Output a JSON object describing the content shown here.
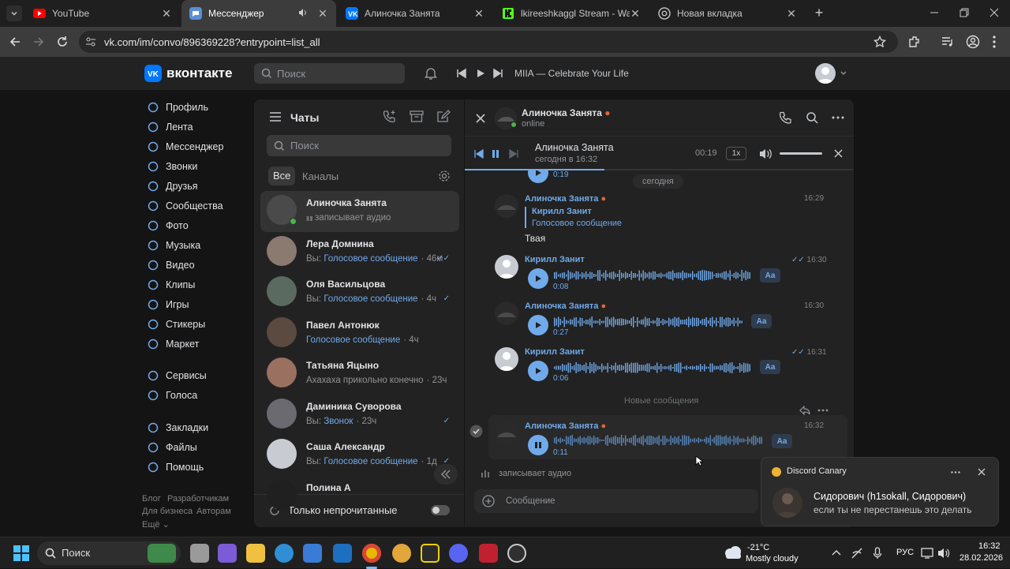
{
  "browser": {
    "tabs": [
      {
        "title": "YouTube",
        "icon": "youtube-icon"
      },
      {
        "title": "Мессенджер",
        "icon": "vk-messenger-icon"
      },
      {
        "title": "Алиночка Занята",
        "icon": "vk-icon"
      },
      {
        "title": "lkireeshkaggl Stream - Watch Li",
        "icon": "kick-icon"
      },
      {
        "title": "Новая вкладка",
        "icon": "chrome-icon"
      }
    ],
    "url": "vk.com/im/convo/896369228?entrypoint=list_all"
  },
  "vk": {
    "logo_text": "вконтакте",
    "search_placeholder": "Поиск",
    "now_playing": "MIIA — Celebrate Your Life",
    "sidebar": {
      "items": [
        {
          "label": "Профиль",
          "icon": "profile-icon"
        },
        {
          "label": "Лента",
          "icon": "feed-icon"
        },
        {
          "label": "Мессенджер",
          "icon": "messenger-icon"
        },
        {
          "label": "Звонки",
          "icon": "phone-icon"
        },
        {
          "label": "Друзья",
          "icon": "friends-icon"
        },
        {
          "label": "Сообщества",
          "icon": "communities-icon"
        },
        {
          "label": "Фото",
          "icon": "photo-icon"
        },
        {
          "label": "Музыка",
          "icon": "music-icon"
        },
        {
          "label": "Видео",
          "icon": "video-icon"
        },
        {
          "label": "Клипы",
          "icon": "clips-icon"
        },
        {
          "label": "Игры",
          "icon": "games-icon"
        },
        {
          "label": "Стикеры",
          "icon": "stickers-icon"
        },
        {
          "label": "Маркет",
          "icon": "market-icon"
        }
      ],
      "items2": [
        {
          "label": "Сервисы",
          "icon": "services-icon"
        },
        {
          "label": "Голоса",
          "icon": "votes-icon"
        }
      ],
      "items3": [
        {
          "label": "Закладки",
          "icon": "bookmarks-icon"
        },
        {
          "label": "Файлы",
          "icon": "files-icon"
        },
        {
          "label": "Помощь",
          "icon": "help-icon"
        }
      ],
      "footer": {
        "blog": "Блог",
        "dev": "Разработчикам",
        "business": "Для бизнеса",
        "authors": "Авторам",
        "more": "Ещё"
      }
    },
    "chats": {
      "title": "Чаты",
      "search_placeholder": "Поиск",
      "tab_all": "Все",
      "tab_channels": "Каналы",
      "unread_only": "Только непрочитанные",
      "items": [
        {
          "name": "Алиночка Занята",
          "preview": "записывает аудио",
          "prefix": "",
          "time": "",
          "avatar": "#4a4a4a",
          "active": true
        },
        {
          "name": "Лера Домнина",
          "prefix": "Вы: ",
          "preview": "Голосовое сообщение",
          "time": "· 46м",
          "avatar": "#8a7a70"
        },
        {
          "name": "Оля Васильцова",
          "prefix": "Вы: ",
          "preview": "Голосовое сообщение",
          "time": "· 4ч",
          "avatar": "#5a6a60"
        },
        {
          "name": "Павел Антонюк",
          "prefix": "",
          "preview": "Голосовое сообщение",
          "time": "· 4ч",
          "avatar": "#5a4a40"
        },
        {
          "name": "Татьяна Яцыно",
          "prefix": "",
          "preview": "Ахахаха прикольно конечно",
          "time": "· 23ч",
          "avatar": "#9a7060"
        },
        {
          "name": "Даминика Суворова",
          "prefix": "Вы: ",
          "preview": "Звонок",
          "time": "· 23ч",
          "avatar": "#6a6a70"
        },
        {
          "name": "Саша Александр",
          "prefix": "Вы: ",
          "preview": "Голосовое сообщение",
          "time": "· 1д",
          "avatar": "#c8ccd2"
        },
        {
          "name": "Полина А",
          "prefix": "",
          "preview": "",
          "time": "",
          "avatar": "#202020"
        }
      ]
    },
    "convo": {
      "name": "Алиночка Занята",
      "status": "online",
      "player": {
        "title": "Алиночка Занята",
        "subtitle": "сегодня в 16:32",
        "time": "00:19",
        "speed": "1x"
      },
      "date_sep": "сегодня",
      "new_messages": "Новые сообщения",
      "messages": [
        {
          "author": "Алиночка Занята",
          "time": "16:29",
          "reply_name": "Кирилл Занит",
          "reply_text": "Голосовое сообщение",
          "text": "Твая"
        },
        {
          "author": "Кирилл Занит",
          "time": "16:30",
          "duration": "0:08"
        },
        {
          "author": "Алиночка Занята",
          "time": "16:30",
          "duration": "0:27"
        },
        {
          "author": "Кирилл Занит",
          "time": "16:31",
          "duration": "0:06"
        },
        {
          "author": "Алиночка Занята",
          "time": "16:32",
          "duration": "0:11"
        }
      ],
      "prev_duration": "0:19",
      "aa_label": "Aa",
      "recording": "записывает аудио",
      "input_placeholder": "Сообщение"
    }
  },
  "notification": {
    "app": "Discord Canary",
    "title": "Сидорович (h1sokall, Сидорович)",
    "body": "если ты не перестанешь это делать"
  },
  "taskbar": {
    "search": "Поиск",
    "weather_temp": "-21°C",
    "weather_desc": "Mostly cloudy",
    "lang": "РУС",
    "time": "16:32",
    "date": "28.02.2026"
  }
}
